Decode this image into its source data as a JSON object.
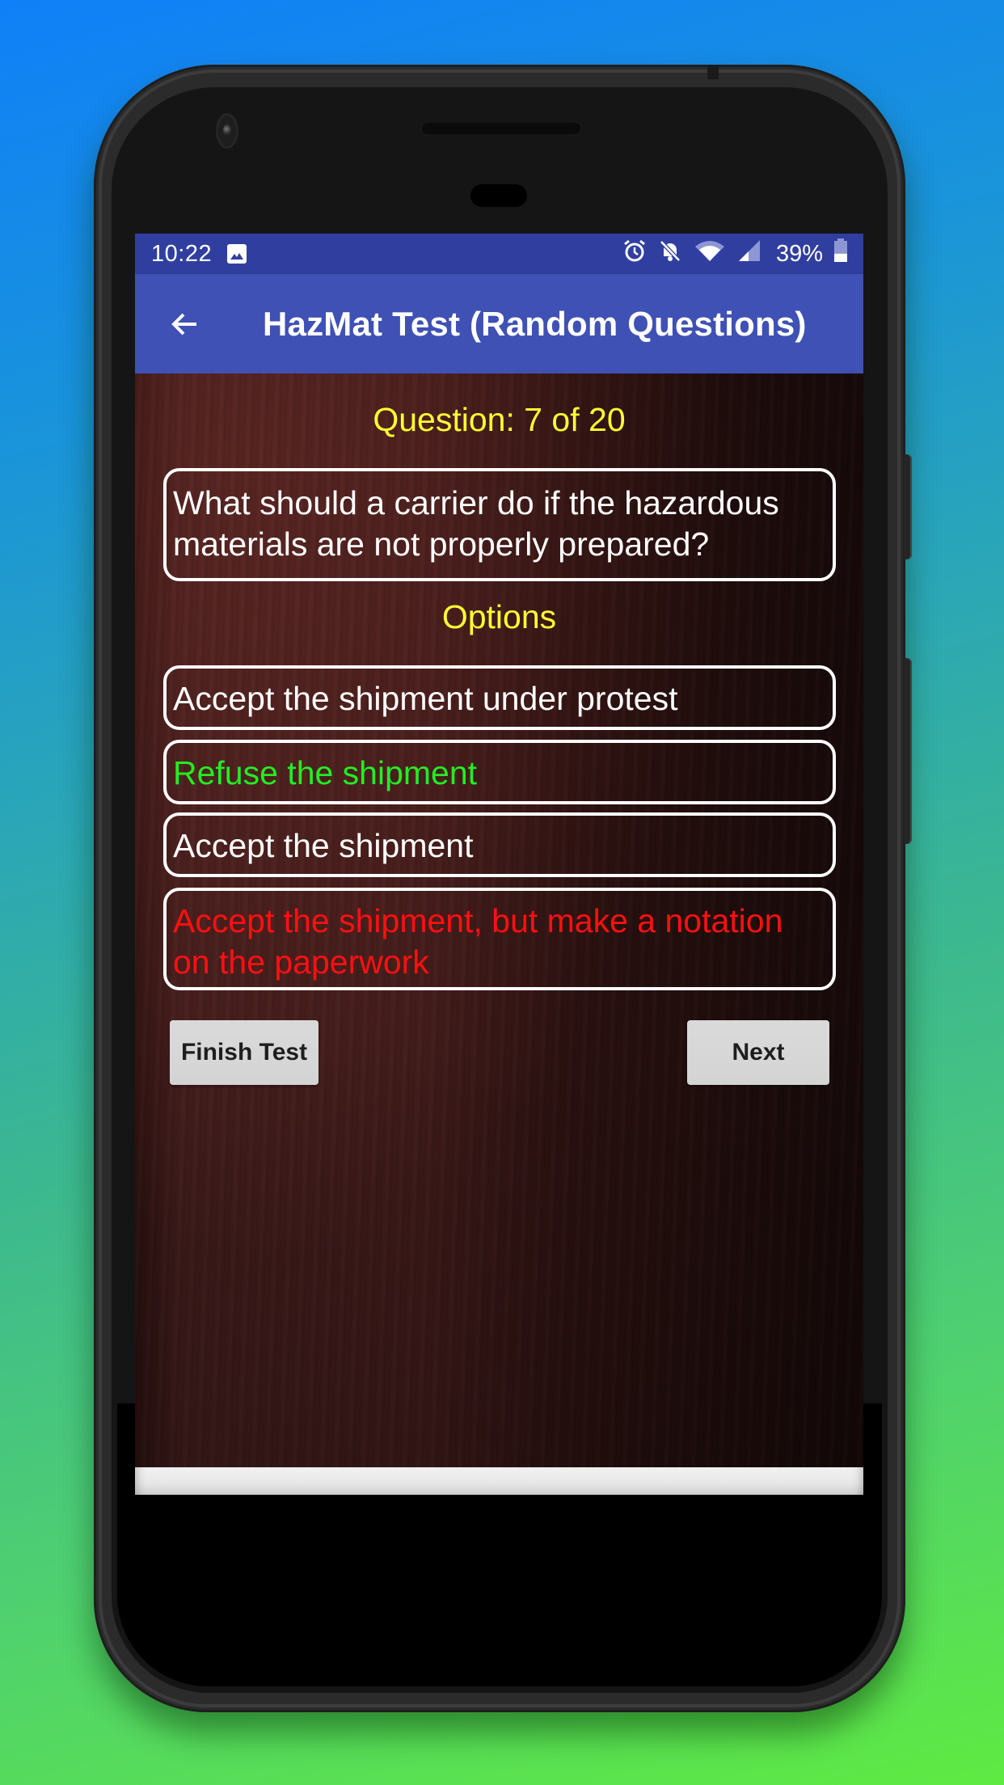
{
  "status_bar": {
    "time": "10:22",
    "left_icons": [
      "image-notification-icon"
    ],
    "right_icons": [
      "alarm-icon",
      "bell-muted-icon",
      "wifi-icon",
      "cell-signal-icon",
      "battery-icon"
    ],
    "battery_percent_text": "39%",
    "battery_level": 0.39,
    "bg_color": "#303f9f"
  },
  "app_bar": {
    "back_icon": "arrow-left-icon",
    "title": "HazMat Test (Random Questions)",
    "bg_color": "#3f51b5"
  },
  "quiz": {
    "counter": "Question: 7 of 20",
    "current_question": 7,
    "total_questions": 20,
    "question": "What should a carrier do if the hazardous materials are not properly prepared?",
    "options_heading": "Options",
    "options": [
      {
        "text": "Accept the shipment under protest",
        "state": "neutral",
        "color": "#ffffff"
      },
      {
        "text": "Refuse the shipment",
        "state": "correct",
        "color": "#22ee22"
      },
      {
        "text": "Accept the shipment",
        "state": "neutral",
        "color": "#ffffff"
      },
      {
        "text": "Accept the shipment, but make a notation on the paperwork",
        "state": "wrong-selected",
        "color": "#ff1010"
      }
    ],
    "heading_color": "#ffff33"
  },
  "buttons": {
    "finish_label": "Finish Test",
    "next_label": "Next"
  }
}
